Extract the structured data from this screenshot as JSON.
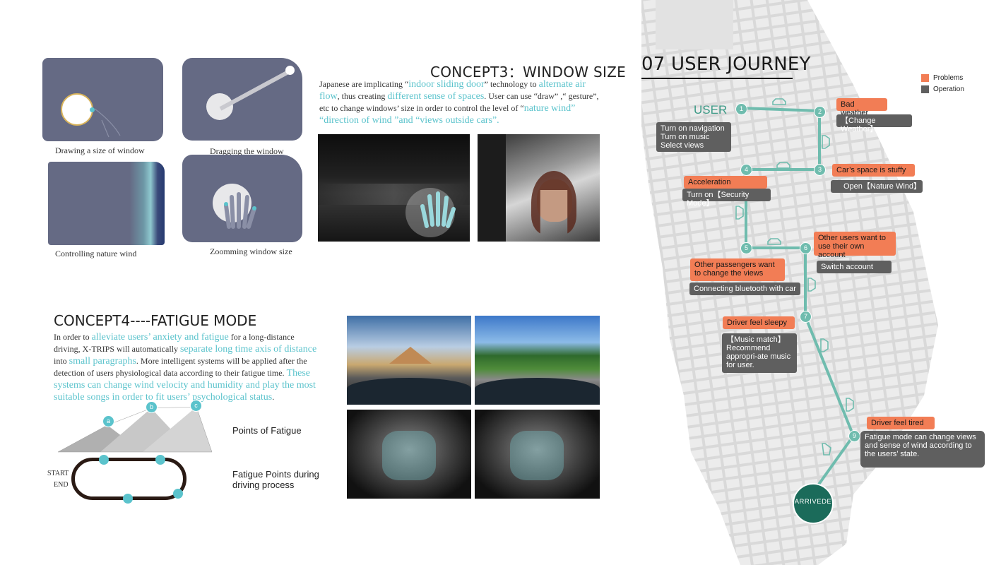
{
  "concept3": {
    "title": "CONCEPT3：WINDOW SIZE",
    "para": [
      {
        "t": "Japanese are implicating “",
        "h": false
      },
      {
        "t": "indoor sliding door",
        "h": true
      },
      {
        "t": "” technology to ",
        "h": false
      },
      {
        "t": "alternate air flow",
        "h": true
      },
      {
        "t": ", thus creating ",
        "h": false
      },
      {
        "t": "different sense of spaces",
        "h": true
      },
      {
        "t": ". User can use “draw” ,“ gesture”, etc to change windows’ size in order to control the level of “",
        "h": false
      },
      {
        "t": "nature wind” “direction of wind ”and “views outside cars”.",
        "h": true
      }
    ],
    "captions": {
      "draw": "Drawing a size of window",
      "drag": "Dragging the window",
      "wind": "Controlling nature wind",
      "zoom": "Zoomming window size"
    }
  },
  "concept4": {
    "title": "CONCEPT4----FATIGUE MODE",
    "para": [
      {
        "t": "In order to ",
        "h": false
      },
      {
        "t": "alleviate users’ anxiety and fatigue",
        "h": true
      },
      {
        "t": " for a long-distance driving, X-TRIPS will automatically ",
        "h": false
      },
      {
        "t": "separate long time axis of distance",
        "h": true
      },
      {
        "t": " into ",
        "h": false
      },
      {
        "t": "small paragraphs",
        "h": true
      },
      {
        "t": ". More intelligent systems will be applied after the detection of users physiological data according to their fatigue time. ",
        "h": false
      },
      {
        "t": "These systems can change wind velocity and humidity and play the most suitable songs in order to fit users’ psychological status",
        "h": true
      },
      {
        "t": ".",
        "h": false
      }
    ],
    "peak_labels": [
      "a",
      "b",
      "c"
    ],
    "points_label": "Points of Fatigue",
    "track_label": "Fatigue Points during driving process",
    "start_label": "START",
    "end_label": "END"
  },
  "journey": {
    "title": "07 USER JOURNEY",
    "user_label": "USER",
    "arrive_label": "ARRIVEDE",
    "legend": [
      {
        "label": "Problems",
        "color": "#f27d55"
      },
      {
        "label": "Operation",
        "color": "#5f5f5f"
      }
    ],
    "nodes": [
      "1",
      "2",
      "3",
      "4",
      "5",
      "6",
      "7",
      "9"
    ],
    "tags": {
      "user_ops": "Turn on  navigation\nTurn on music\nSelect views",
      "bad_weather": "Bad weather",
      "change_weather": "【Change Weather】",
      "stuffy": "Car’s space is stuffy",
      "nature_wind": "Open【Nature Wind】",
      "acceleration": "Acceleration",
      "security": "Turn on【Security Mode】",
      "other_users": "Other users want to use their own account",
      "switch": "Switch account",
      "passengers": "Other passengers want to change the views",
      "bluetooth": "Connecting bluetooth with car",
      "sleepy": "Driver feel sleepy",
      "music": "【Music match】\nRecommend appropri-ate music for user.",
      "tired": "Driver feel tired",
      "fatigue_mode": "Fatigue mode can change views and sense of wind according to the users’ state."
    },
    "colors": {
      "route": "#6fbcae",
      "arrive": "#1b6b5a",
      "problem": "#f27d55",
      "operation": "#5f5f5f"
    }
  }
}
